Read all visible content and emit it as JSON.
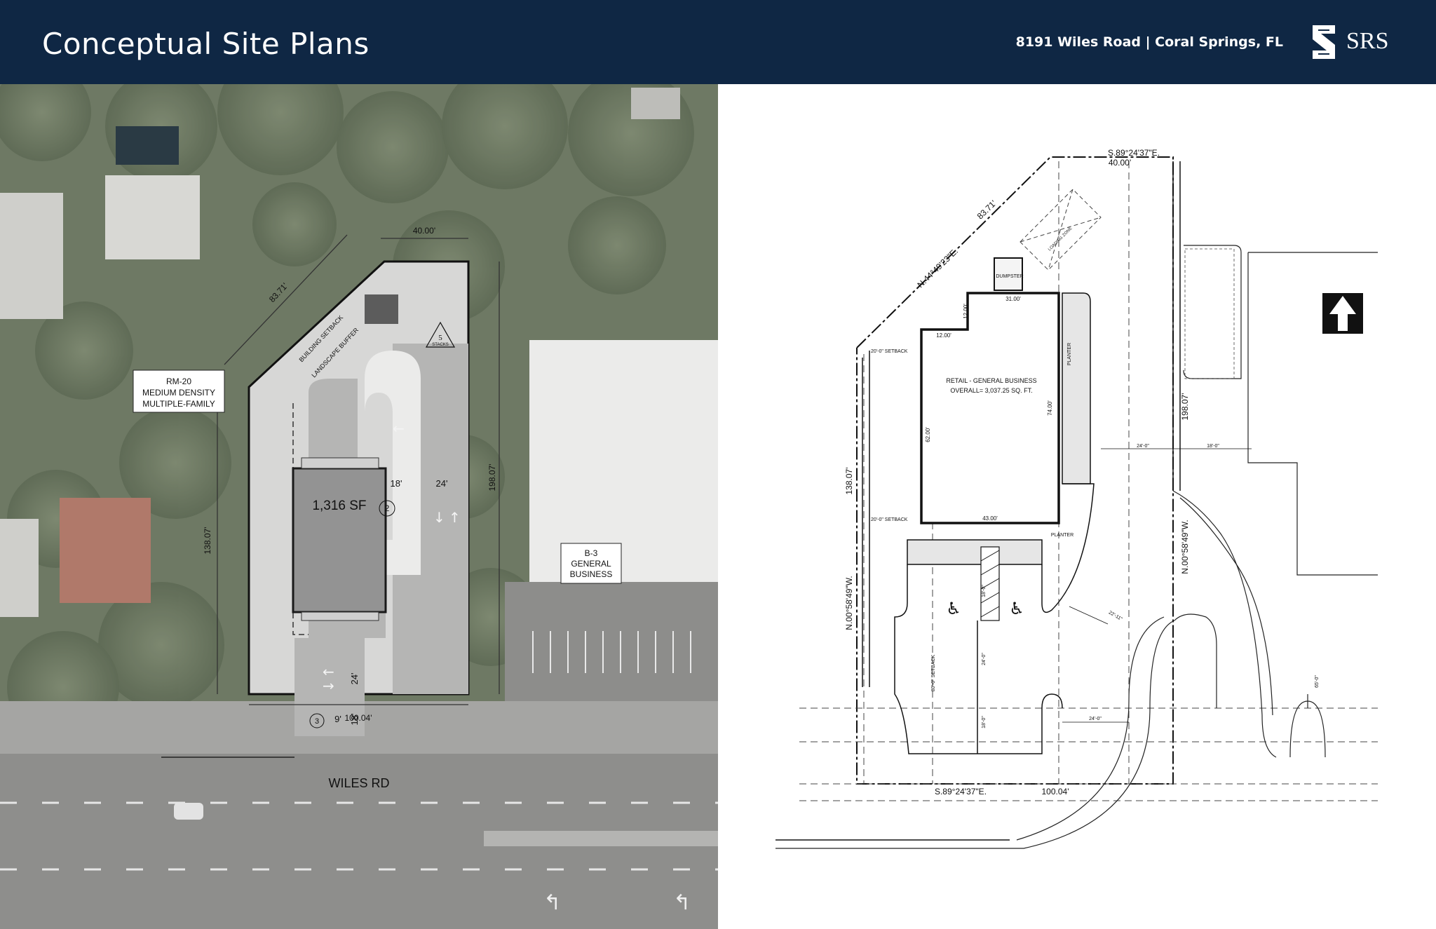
{
  "header": {
    "title": "Conceptual Site Plans",
    "address": "8191 Wiles Road | Coral Springs, FL",
    "logo_text": "SRS",
    "logo_icon": "srs-s-mark-icon",
    "bg_color": "#0f2744"
  },
  "aerial_plan": {
    "zoning_left": [
      "RM-20",
      "MEDIUM DENSITY",
      "MULTIPLE-FAMILY"
    ],
    "zoning_right": [
      "B-3",
      "GENERAL",
      "BUSINESS"
    ],
    "building_label": "1,316 SF",
    "dim_top": "40.00'",
    "dim_diagonal": "83.71'",
    "dim_left": "138.07'",
    "dim_right": "198.07'",
    "dim_bottom": "100.04'",
    "road_label": "WILES RD",
    "setback_label": "BUILDING SETBACK",
    "buffer_label": "LANDSCAPE BUFFER",
    "stacks_number": "5",
    "stacks_label": "STACKS",
    "stall_count_top": "2",
    "stall_count_bottom": "3",
    "dim_18_top": "18'",
    "dim_24_top": "24'",
    "dim_24_lower": "24'",
    "dim_9": "9'",
    "dim_18_lower": "18'"
  },
  "cad_plan": {
    "bearing_top": "S.89°24'37\"E.",
    "dim_top": "40.00'",
    "bearing_diagonal": "N.44°49'23\"E.",
    "dim_diagonal": "83.71'",
    "loading_label": "LOADING ZONE",
    "dumpster_label": "DUMPSTER",
    "retail_title": "RETAIL - GENERAL BUSINESS",
    "retail_area": "OVERALL= 3,037.25 SQ. FT.",
    "dim_31": "31.00'",
    "dim_12a": "12.00'",
    "dim_12b": "12.00'",
    "dim_62": "62.00'",
    "dim_74": "74.00'",
    "dim_43": "43.00'",
    "setback_top": "20'-0\" SETBACK",
    "setback_mid": "20'-0\" SETBACK",
    "setback_vertical": "80'-0\" SETBACK",
    "planter_right": "PLANTER",
    "planter_bottom": "PLANTER",
    "dim_left": "138.07'",
    "bearing_left": "N.00°58'49\"W.",
    "dim_right": "198.07'",
    "bearing_right": "N.00°58'49\"W.",
    "bearing_bottom": "S.89°24'37\"E.",
    "dim_bottom": "100.04'",
    "dim_24_0a": "24'-0\"",
    "dim_18_0a": "18'-0\"",
    "dim_24_0b": "24'-0\"",
    "dim_24_0c": "24'-0\"",
    "dim_18_0b": "18'-0\"",
    "dim_18_0c": "18'-0\"",
    "dim_22_11": "22'-11\"",
    "dim_65": "65'-0\"",
    "north_arrow_icon": "north-arrow-icon",
    "accessible_icon": "wheelchair-icon"
  }
}
